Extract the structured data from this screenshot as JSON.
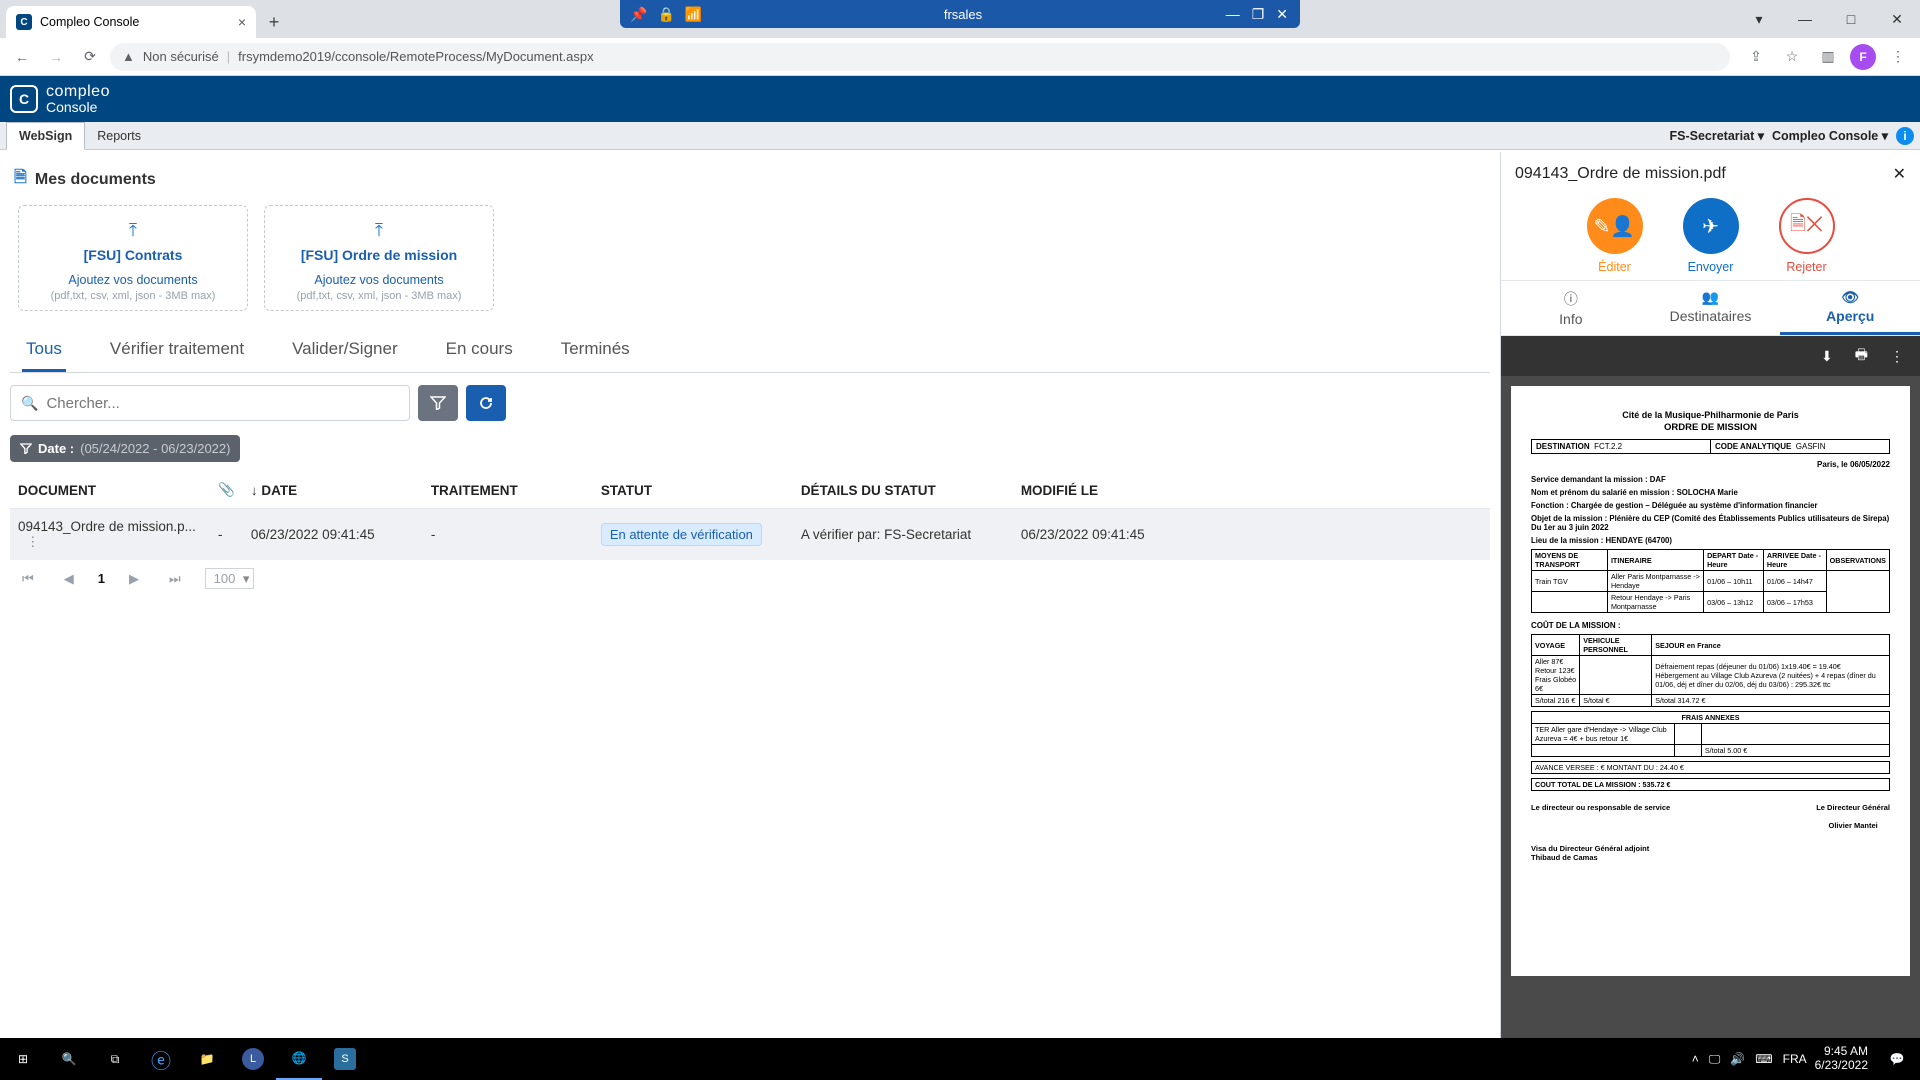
{
  "remote": {
    "title": "frsales"
  },
  "browser": {
    "tab_title": "Compleo Console",
    "address_warn": "Non sécurisé",
    "url": "frsymdemo2019/cconsole/RemoteProcess/MyDocument.aspx",
    "avatar_letter": "F"
  },
  "app_header": {
    "brand_a": "compleo",
    "brand_b": "Console"
  },
  "subnav": {
    "items": [
      "WebSign",
      "Reports"
    ],
    "active_index": 0,
    "right_user": "FS-Secretariat",
    "right_app": "Compleo Console"
  },
  "page": {
    "title": "Mes documents",
    "drop_cards": [
      {
        "title": "[FSU] Contrats",
        "sub": "Ajoutez vos documents",
        "hint": "(pdf,txt, csv, xml, json - 3MB max)"
      },
      {
        "title": "[FSU] Ordre de mission",
        "sub": "Ajoutez vos documents",
        "hint": "(pdf,txt, csv, xml, json - 3MB max)"
      }
    ],
    "doc_tabs": [
      "Tous",
      "Vérifier traitement",
      "Valider/Signer",
      "En cours",
      "Terminés"
    ],
    "active_doc_tab": 0,
    "search_placeholder": "Chercher...",
    "filter_chip": {
      "label": "Date :",
      "range": "(05/24/2022 - 06/23/2022)"
    },
    "columns": {
      "document": "DOCUMENT",
      "date": "DATE",
      "traitement": "TRAITEMENT",
      "statut": "STATUT",
      "details": "DÉTAILS DU STATUT",
      "modifie": "MODIFIÉ LE"
    },
    "rows": [
      {
        "document": "094143_Ordre de mission.p...",
        "attachment": "-",
        "date": "06/23/2022 09:41:45",
        "traitement": "-",
        "statut": "En attente de vérification",
        "details": "A vérifier par: FS-Secretariat",
        "modifie": "06/23/2022 09:41:45"
      }
    ],
    "pager": {
      "current": "1",
      "page_size": "100"
    }
  },
  "preview": {
    "filename": "094143_Ordre de mission.pdf",
    "actions": {
      "edit": "Éditer",
      "send": "Envoyer",
      "reject": "Rejeter"
    },
    "tabs": {
      "info": "Info",
      "dest": "Destinataires",
      "apercu": "Aperçu"
    }
  },
  "doc": {
    "org": "Cité de la Musique-Philharmonie de Paris",
    "doctype": "ORDRE DE MISSION",
    "dest_label": "DESTINATION",
    "dest_val": "FCT.2.2",
    "code_label": "CODE ANALYTIQUE",
    "code_val": "GASFIN",
    "city_date": "Paris, le 06/05/2022",
    "l1": "Service demandant la mission : DAF",
    "l2": "Nom et prénom du salarié en mission : SOLOCHA Marie",
    "l3": "Fonction : Chargée de gestion – Déléguée au système d'information financier",
    "l4a": "Objet de la mission : Plénière du CEP (Comité des Établissements Publics utilisateurs de Sirepa)",
    "l4b": "Du 1er au 3 juin 2022",
    "l5": "Lieu de la mission : HENDAYE (64700)",
    "transport_headers": [
      "MOYENS DE TRANSPORT",
      "ITINERAIRE",
      "DEPART Date - Heure",
      "ARRIVEE Date - Heure",
      "OBSERVATIONS"
    ],
    "transport_rows": [
      [
        "Train TGV",
        "Aller Paris Montparnasse -> Hendaye",
        "01/06 – 10h11",
        "01/06 – 14h47",
        ""
      ],
      [
        "",
        "Retour Hendaye -> Paris Montparnasse",
        "03/06 – 13h12",
        "03/06 – 17h53",
        ""
      ]
    ],
    "cost_title": "COÛT DE LA MISSION :",
    "cost_headers": [
      "VOYAGE",
      "VEHICULE PERSONNEL",
      "SEJOUR en France"
    ],
    "cost_col1": [
      "Aller 87€",
      "Retour 123€",
      "Frais Globéo 6€"
    ],
    "cost_col3": "Défraiement repas (déjeuner du 01/06) 1x19.40€ = 19.40€\nHébergement au Village Club Azureva (2 nuitées) + 4 repas (dîner du 01/06, déj et dîner du 02/06, déj du 03/06) : 295.32€ ttc",
    "subtotal_a": "S/total     216  €",
    "subtotal_b": "S/total          €",
    "subtotal_c": "S/total     314.72  €",
    "annex_title": "FRAIS ANNEXES",
    "annex_text": "TER Aller gare d'Hendaye -> Village Club Azureva = 4€ + bus retour 1€",
    "annex_sub": "S/total        5.00   €",
    "avance": "AVANCE VERSEE :                    €        MONTANT DU :   24.40    €",
    "total": "COUT TOTAL DE LA MISSION :        535.72  €",
    "sig_left": "Le directeur ou responsable de service",
    "sig_right_title": "Le Directeur Général",
    "sig_right_name": "Olivier Mantei",
    "visa": "Visa du Directeur Général adjoint\nThibaud de Camas"
  },
  "taskbar": {
    "lang": "FRA",
    "time": "9:45 AM",
    "date": "6/23/2022"
  }
}
